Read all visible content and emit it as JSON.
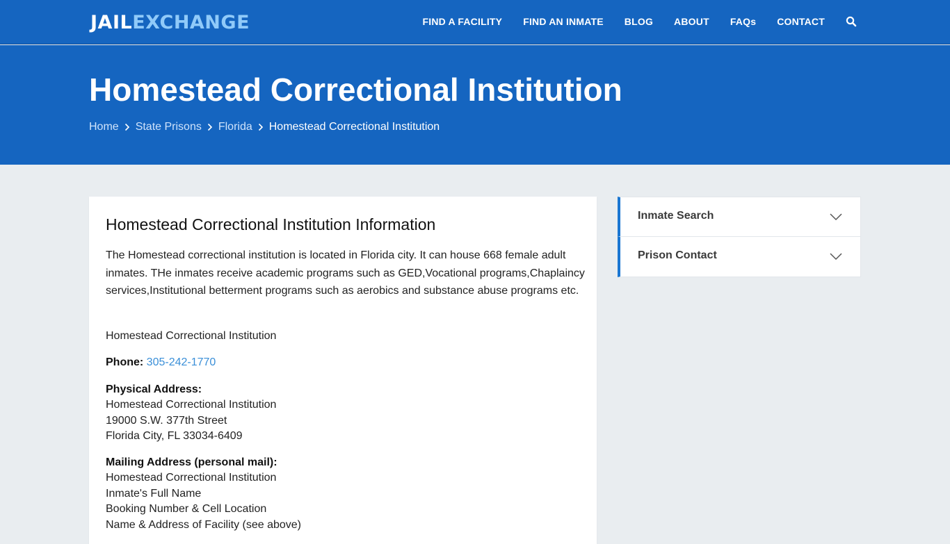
{
  "logo": {
    "part1": "JAIL",
    "part2": "EXCHANGE"
  },
  "nav": {
    "items": [
      "FIND A FACILITY",
      "FIND AN INMATE",
      "BLOG",
      "ABOUT",
      "FAQs",
      "CONTACT"
    ],
    "search_icon": "search-icon"
  },
  "hero": {
    "title": "Homestead Correctional Institution",
    "breadcrumb": [
      "Home",
      "State Prisons",
      "Florida",
      "Homestead Correctional Institution"
    ]
  },
  "main": {
    "heading": "Homestead Correctional Institution Information",
    "description": "The Homestead correctional institution is located in Florida city. It can house 668 female adult inmates. THe inmates receive academic programs such as GED,Vocational programs,Chaplaincy services,Institutional betterment programs such as aerobics and substance abuse programs etc.",
    "facility_name": "Homestead Correctional Institution",
    "phone_label": "Phone:",
    "phone_value": "305-242-1770",
    "physical": {
      "label": "Physical Address:",
      "lines": [
        "Homestead Correctional Institution",
        "19000 S.W. 377th Street",
        "Florida City, FL 33034-6409"
      ]
    },
    "mailing": {
      "label": "Mailing Address (personal mail):",
      "lines": [
        "Homestead Correctional Institution",
        "Inmate's Full Name",
        "Booking Number & Cell Location",
        "Name & Address of Facility (see above)"
      ]
    }
  },
  "sidebar": {
    "items": [
      "Inmate Search",
      "Prison Contact"
    ]
  },
  "colors": {
    "brand_blue": "#1565c0",
    "logo_accent": "#90caf9",
    "link": "#3a8fd8",
    "page_bg": "#e9edf0"
  }
}
